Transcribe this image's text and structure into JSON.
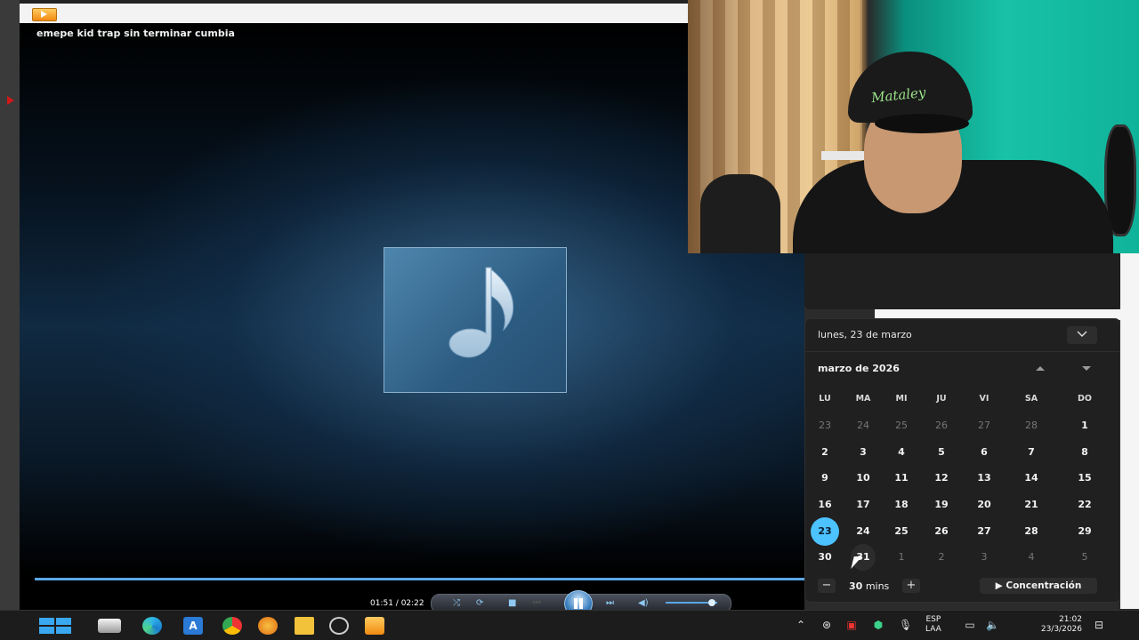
{
  "player": {
    "track_title": "emepe kid trap sin terminar cumbia",
    "time": "01:51 / 02:22",
    "progress": 0.78
  },
  "webcam": {
    "cap_text": "Mataley"
  },
  "calendar": {
    "date_label": "lunes, 23 de marzo",
    "month_label": "marzo de 2026",
    "weekdays": [
      "LU",
      "MA",
      "MI",
      "JU",
      "VI",
      "SA",
      "DO"
    ],
    "weeks": [
      [
        "23",
        "24",
        "25",
        "26",
        "27",
        "28",
        "1"
      ],
      [
        "2",
        "3",
        "4",
        "5",
        "6",
        "7",
        "8"
      ],
      [
        "9",
        "10",
        "11",
        "12",
        "13",
        "14",
        "15"
      ],
      [
        "16",
        "17",
        "18",
        "19",
        "20",
        "21",
        "22"
      ],
      [
        "23",
        "24",
        "25",
        "26",
        "27",
        "28",
        "29"
      ],
      [
        "30",
        "31",
        "1",
        "2",
        "3",
        "4",
        "5"
      ]
    ],
    "today": "23",
    "focus": {
      "minutes": "30",
      "minutes_unit": "mins",
      "minus": "−",
      "plus": "+",
      "start_label": "Concentración"
    }
  },
  "taskbar": {
    "language": "ESP",
    "layout": "LAA",
    "time": "21:02",
    "date": "23/3/2026"
  },
  "colors": {
    "accent": "#4cc2ff",
    "player_progress": "#5aa8e6",
    "calendar_bg": "#202020",
    "taskbar_bg": "#1c1c1c"
  }
}
